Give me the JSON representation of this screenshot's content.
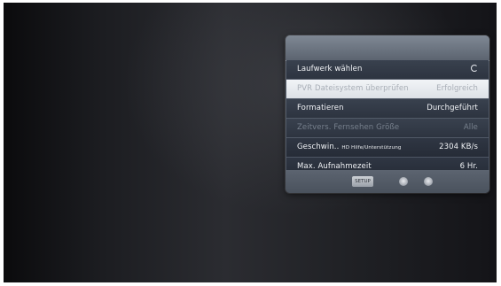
{
  "menu": {
    "rows": [
      {
        "label": "Laufwerk wählen",
        "value": "",
        "value_icon": "spinner-icon",
        "state": "normal"
      },
      {
        "label": "PVR Dateisystem überprüfen",
        "value": "Erfolgreich",
        "state": "selected"
      },
      {
        "label": "Formatieren",
        "value": "Durchgeführt",
        "state": "normal"
      },
      {
        "label": "Zeitvers. Fernsehen Größe",
        "value": "Alle",
        "state": "disabled"
      },
      {
        "label": "Geschwin..",
        "label_sub": "HD Hilfe/Unterstützung",
        "value": "2304 KB/s",
        "state": "normal"
      },
      {
        "label": "Max. Aufnahmezeit",
        "value": "6 Hr.",
        "state": "normal"
      }
    ],
    "footer": {
      "setup_label": "SETUP",
      "nav_icons": [
        "circle-button-icon",
        "circle-button-icon"
      ]
    }
  },
  "colors": {
    "panel": "#4f5764",
    "row": "#323945",
    "selected_row": "#e8ebef",
    "text": "#f1f3f6",
    "disabled_text": "#77808d"
  }
}
